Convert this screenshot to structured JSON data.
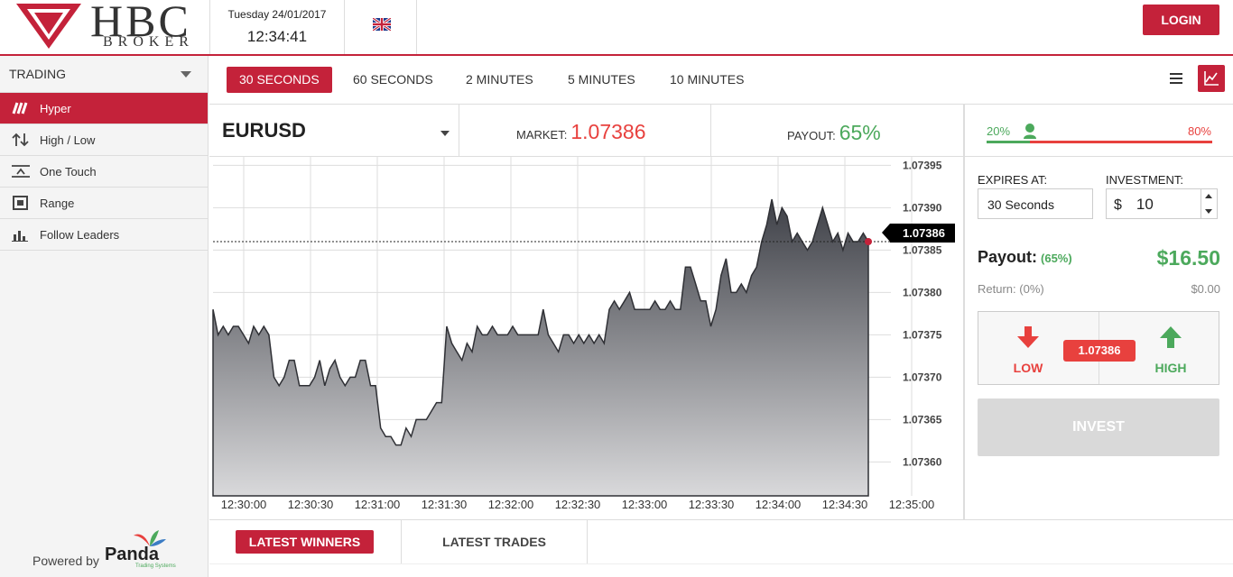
{
  "header": {
    "brand": "HBC",
    "brand_sub": "BROKER",
    "date": "Tuesday 24/01/2017",
    "time": "12:34:41",
    "login_label": "LOGIN"
  },
  "sidebar": {
    "title": "TRADING",
    "items": [
      {
        "label": "Hyper",
        "icon": "hyper-icon",
        "active": true
      },
      {
        "label": "High / Low",
        "icon": "high-low-icon",
        "active": false
      },
      {
        "label": "One Touch",
        "icon": "one-touch-icon",
        "active": false
      },
      {
        "label": "Range",
        "icon": "range-icon",
        "active": false
      },
      {
        "label": "Follow Leaders",
        "icon": "follow-leaders-icon",
        "active": false
      }
    ],
    "powered_by": "Powered by",
    "powered_brand": "Panda",
    "powered_brand_sub": "Trading Systems"
  },
  "tabs": [
    "30 SECONDS",
    "60 SECONDS",
    "2 MINUTES",
    "5 MINUTES",
    "10 MINUTES"
  ],
  "asset": {
    "name": "EURUSD",
    "market_label": "MARKET:",
    "market_value": "1.07386",
    "payout_label": "PAYOUT:",
    "payout_value": "65%"
  },
  "sentiment": {
    "low_pct": "20%",
    "high_pct": "80%",
    "low_fraction": 0.2
  },
  "chart_data": {
    "type": "area",
    "x_ticks": [
      "12:30:00",
      "12:30:30",
      "12:31:00",
      "12:31:30",
      "12:32:00",
      "12:32:30",
      "12:33:00",
      "12:33:30",
      "12:34:00",
      "12:34:30",
      "12:35:00"
    ],
    "y_ticks": [
      "1.07395",
      "1.07390",
      "1.07385",
      "1.07380",
      "1.07375",
      "1.07370",
      "1.07365",
      "1.07360"
    ],
    "ylim": [
      1.07356,
      1.07396
    ],
    "current_price": "1.07386",
    "series": [
      {
        "values": [
          1.07378,
          1.07375,
          1.07376,
          1.07375,
          1.07376,
          1.07376,
          1.07375,
          1.07374,
          1.07376,
          1.07375,
          1.07376,
          1.07375,
          1.0737,
          1.07369,
          1.0737,
          1.07372,
          1.07372,
          1.07369,
          1.07369,
          1.07369,
          1.0737,
          1.07372,
          1.07369,
          1.07371,
          1.07372,
          1.0737,
          1.07369,
          1.0737,
          1.0737,
          1.07372,
          1.07372,
          1.07369,
          1.07369,
          1.07364,
          1.07363,
          1.07363,
          1.07362,
          1.07362,
          1.07364,
          1.07363,
          1.07365,
          1.07365,
          1.07365,
          1.07366,
          1.07367,
          1.07367,
          1.07376,
          1.07374,
          1.07373,
          1.07372,
          1.07374,
          1.07373,
          1.07376,
          1.07375,
          1.07375,
          1.07376,
          1.07375,
          1.07375,
          1.07375,
          1.07376,
          1.07375,
          1.07375,
          1.07375,
          1.07375,
          1.07375,
          1.07378,
          1.07375,
          1.07374,
          1.07373,
          1.07375,
          1.07375,
          1.07374,
          1.07375,
          1.07374,
          1.07375,
          1.07374,
          1.07375,
          1.07374,
          1.07378,
          1.07379,
          1.07378,
          1.07379,
          1.0738,
          1.07378,
          1.07378,
          1.07378,
          1.07378,
          1.07379,
          1.07378,
          1.07378,
          1.07379,
          1.07378,
          1.07378,
          1.07383,
          1.07383,
          1.07381,
          1.07379,
          1.07379,
          1.07376,
          1.07378,
          1.07382,
          1.07384,
          1.0738,
          1.0738,
          1.07381,
          1.0738,
          1.07382,
          1.07383,
          1.07386,
          1.07388,
          1.07391,
          1.07388,
          1.0739,
          1.07389,
          1.07386,
          1.07387,
          1.07386,
          1.07385,
          1.07386,
          1.07388,
          1.0739,
          1.07388,
          1.07386,
          1.07387,
          1.07385,
          1.07387,
          1.07386,
          1.07386,
          1.07387,
          1.07386
        ]
      }
    ]
  },
  "trade_panel": {
    "expires_label": "EXPIRES AT:",
    "expires_value": "30 Seconds",
    "investment_label": "INVESTMENT:",
    "currency_symbol": "$",
    "investment_value": "10",
    "payout_label": "Payout:",
    "payout_pct": "(65%)",
    "payout_amount": "$16.50",
    "return_label": "Return:",
    "return_pct": "(0%)",
    "return_amount": "$0.00",
    "low_label": "LOW",
    "high_label": "HIGH",
    "price_badge": "1.07386",
    "invest_label": "INVEST"
  },
  "bottom_tabs": {
    "active": "LATEST WINNERS",
    "other": "LATEST TRADES"
  },
  "colors": {
    "brand": "#c4223a",
    "up": "#4ca95c",
    "down": "#e8413e"
  }
}
